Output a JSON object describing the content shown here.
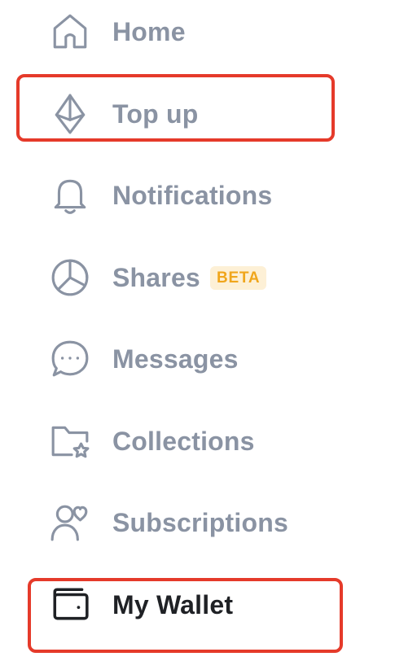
{
  "nav": {
    "items": [
      {
        "label": "Home",
        "icon": "home-icon"
      },
      {
        "label": "Top up",
        "icon": "ethereum-icon"
      },
      {
        "label": "Notifications",
        "icon": "bell-icon"
      },
      {
        "label": "Shares",
        "icon": "pie-chart-icon",
        "badge": "BETA"
      },
      {
        "label": "Messages",
        "icon": "chat-bubble-icon"
      },
      {
        "label": "Collections",
        "icon": "folder-star-icon"
      },
      {
        "label": "Subscriptions",
        "icon": "user-heart-icon"
      },
      {
        "label": "My Wallet",
        "icon": "wallet-icon"
      }
    ],
    "highlighted": [
      "Top up",
      "My Wallet"
    ]
  },
  "colors": {
    "text_muted": "#8a93a3",
    "text_active": "#1f2125",
    "highlight_border": "#e53a2a",
    "badge_bg": "#fdf0d6",
    "badge_text": "#f0a61c"
  }
}
